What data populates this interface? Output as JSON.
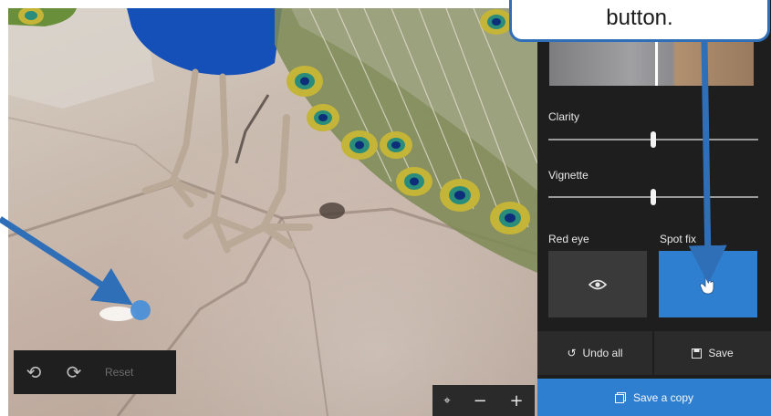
{
  "callout": {
    "text": "button."
  },
  "edit_toolbar": {
    "undo_icon": "undo-icon",
    "redo_icon": "redo-icon",
    "reset_label": "Reset"
  },
  "zoom_toolbar": {
    "fit_icon": "fit-to-window-icon",
    "zoom_out_label": "−",
    "zoom_in_label": "+"
  },
  "panel": {
    "clarity_label": "Clarity",
    "clarity_value": 0.5,
    "vignette_label": "Vignette",
    "vignette_value": 0.5,
    "red_eye_label": "Red eye",
    "red_eye_icon": "eye-icon",
    "spot_fix_label": "Spot fix",
    "spot_fix_icon": "hand-pointer-icon",
    "undo_all_label": "Undo all",
    "save_label": "Save",
    "save_copy_label": "Save a copy"
  },
  "colors": {
    "accent": "#2f7fd0",
    "panel_bg": "#1e1e1e",
    "arrow": "#2f6fb8"
  }
}
